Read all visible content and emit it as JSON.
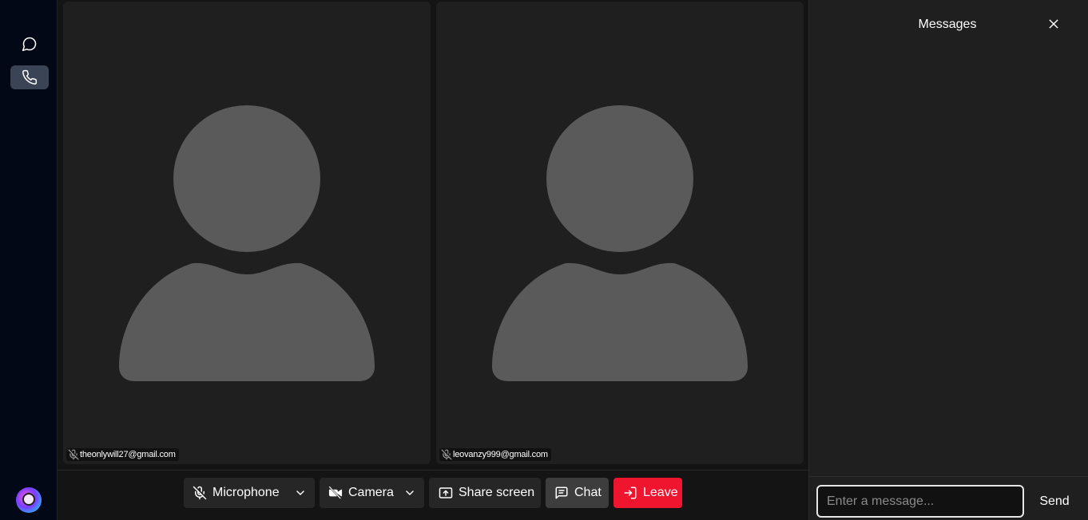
{
  "sidebar": {
    "items": [
      {
        "icon": "chat-bubble-icon",
        "active": false
      },
      {
        "icon": "phone-icon",
        "active": true
      }
    ],
    "avatar": "user-avatar"
  },
  "participants": [
    {
      "name": "theonlywill27@gmail.com",
      "muted": true
    },
    {
      "name": "leovanzy999@gmail.com",
      "muted": true
    }
  ],
  "controls": {
    "microphone_label": "Microphone",
    "camera_label": "Camera",
    "share_label": "Share screen",
    "chat_label": "Chat",
    "leave_label": "Leave"
  },
  "messages_panel": {
    "title": "Messages",
    "input_placeholder": "Enter a message...",
    "send_label": "Send"
  },
  "colors": {
    "leave": "#f0152f",
    "sidebar_bg": "#030817",
    "tile_bg": "#1f1f1f",
    "silhouette": "#5a5a5a"
  }
}
